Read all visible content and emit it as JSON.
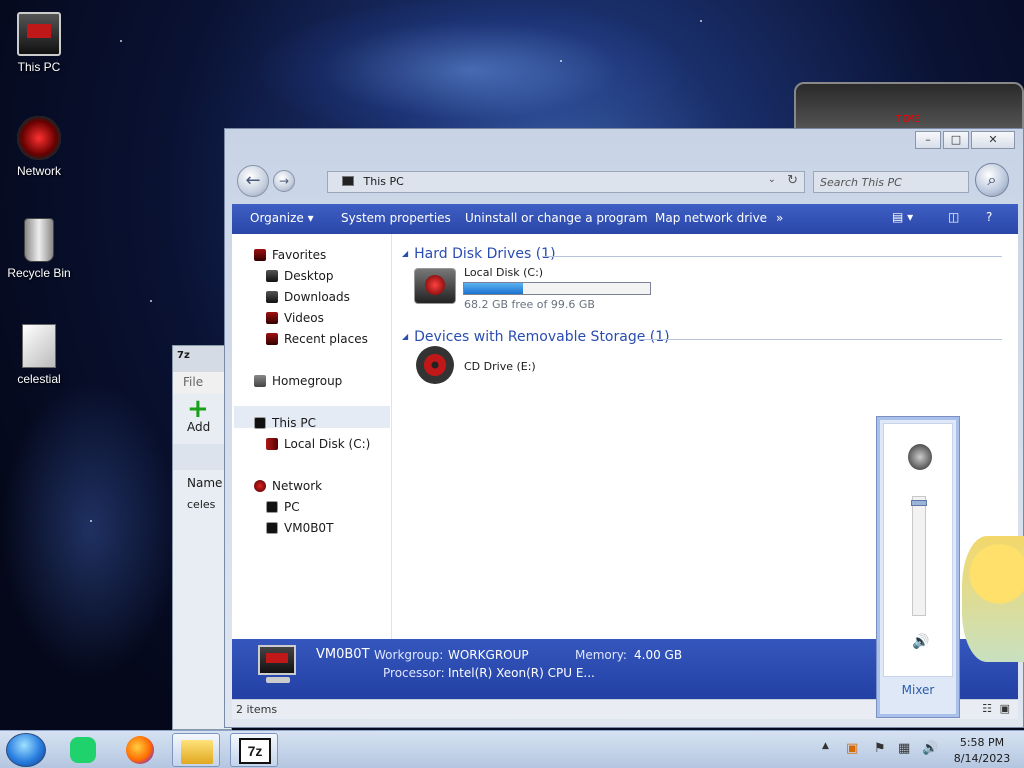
{
  "desktop": {
    "icons": [
      {
        "label": "This PC"
      },
      {
        "label": "Network"
      },
      {
        "label": "Recycle Bin"
      },
      {
        "label": "celestial"
      }
    ],
    "gadget_text": "TIME"
  },
  "bg_window_7z": {
    "title_icon": "7z",
    "menu_file": "File",
    "add_label": "Add",
    "col_name": "Name",
    "item": "celes"
  },
  "explorer": {
    "address": "This PC",
    "search_placeholder": "Search This PC",
    "toolbar": {
      "organize": "Organize",
      "system_properties": "System properties",
      "uninstall": "Uninstall or change a program",
      "map_drive": "Map network drive",
      "more": "»"
    },
    "nav": {
      "favorites": "Favorites",
      "desktop": "Desktop",
      "downloads": "Downloads",
      "videos": "Videos",
      "recent": "Recent places",
      "homegroup": "Homegroup",
      "this_pc": "This PC",
      "local_disk": "Local Disk (C:)",
      "network": "Network",
      "pc": "PC",
      "vm": "VM0B0T"
    },
    "groups": {
      "hdd": "Hard Disk Drives (1)",
      "removable": "Devices with Removable Storage (1)"
    },
    "drive_c": {
      "name": "Local Disk (C:)",
      "free_text": "68.2 GB free of 99.6 GB",
      "used_fraction": 0.315
    },
    "drive_e": {
      "name": "CD Drive (E:)"
    },
    "details": {
      "computer_name": "VM0B0T",
      "workgroup_label": "Workgroup:",
      "workgroup": "WORKGROUP",
      "memory_label": "Memory:",
      "memory": "4.00 GB",
      "processor_label": "Processor:",
      "processor": "Intel(R) Xeon(R) CPU E..."
    },
    "status": "2 items"
  },
  "volume": {
    "mixer": "Mixer",
    "level": 0.97
  },
  "taskbar": {
    "time": "5:58 PM",
    "date": "8/14/2023"
  },
  "colors": {
    "accent": "#2a47a8",
    "link": "#2a4db0",
    "bar": "#1c72d0"
  }
}
